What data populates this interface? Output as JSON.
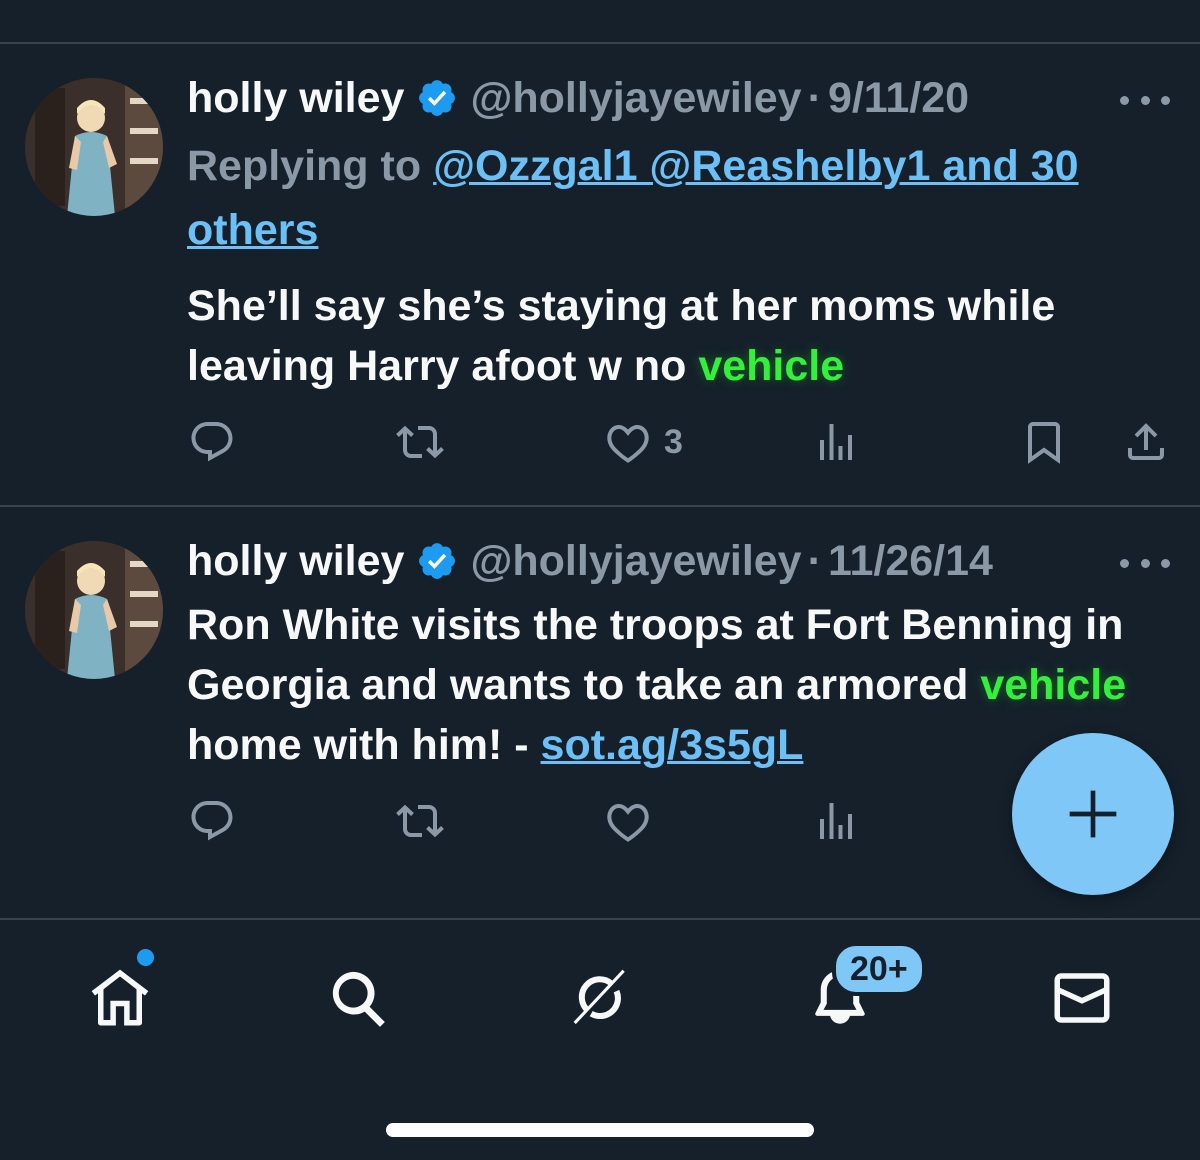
{
  "tweets": [
    {
      "name": "holly wiley",
      "handle": "@hollyjayewiley",
      "separator": "·",
      "date": "9/11/20",
      "replying_prefix": "Replying to",
      "replying_links": "@Ozzgal1 @Reashelby1 and 30 others",
      "text_before": "She’ll say she’s staying at her moms while leaving Harry afoot w no ",
      "text_highlight": "vehicle",
      "text_after": "",
      "link": "",
      "likes": "3"
    },
    {
      "name": "holly wiley",
      "handle": "@hollyjayewiley",
      "separator": "·",
      "date": "11/26/14",
      "text_before": "Ron White visits the troops at Fort Benning in Georgia and wants to take an armored ",
      "text_highlight": "vehicle",
      "text_after": " home with him! - ",
      "link": "sot.ag/3s5gL",
      "likes": ""
    }
  ],
  "icons": {
    "more": "more-dots-icon",
    "verified": "verified-badge-icon",
    "reply": "reply-icon",
    "retweet": "retweet-icon",
    "like": "heart-icon",
    "views": "views-icon",
    "bookmark": "bookmark-icon",
    "share": "share-icon",
    "compose": "plus-icon"
  },
  "tabbar": {
    "tabs": [
      "home",
      "search",
      "grok",
      "notifications",
      "messages"
    ],
    "notifications_badge": "20+"
  },
  "colors": {
    "background": "#15202b",
    "accent": "#1d9bf0",
    "link": "#6cc0f5",
    "highlight": "#33f03d",
    "muted": "#8b98a5",
    "fab": "#7ec7f7"
  }
}
